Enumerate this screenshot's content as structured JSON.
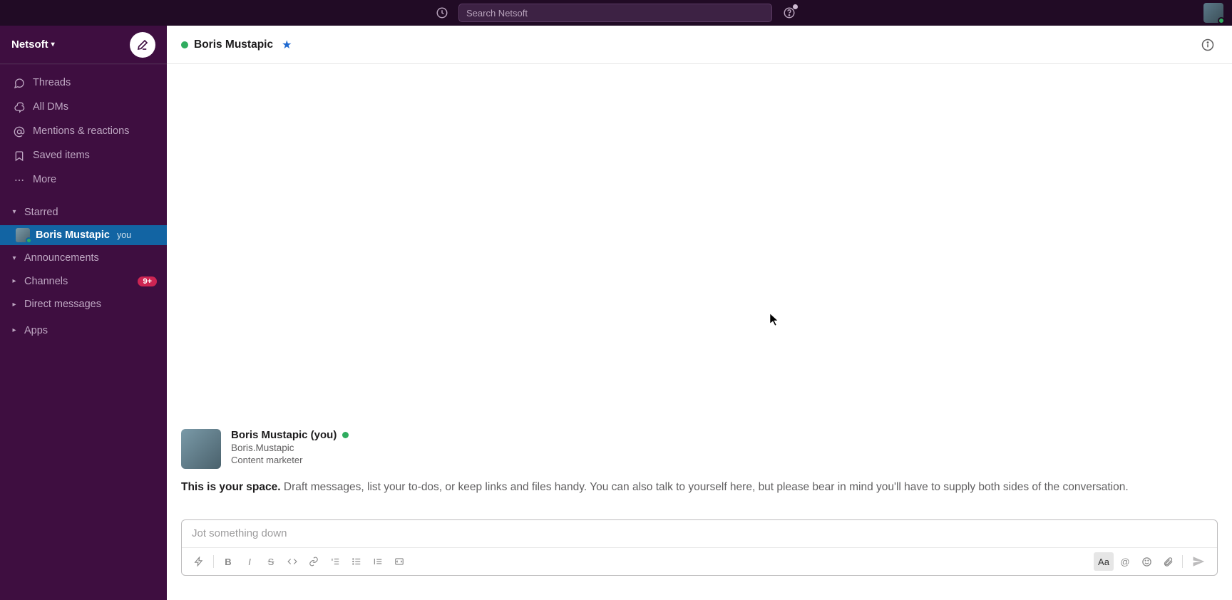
{
  "topbar": {
    "search_placeholder": "Search Netsoft"
  },
  "workspace": {
    "name": "Netsoft"
  },
  "sidebar": {
    "nav": [
      {
        "id": "threads",
        "label": "Threads",
        "icon": "threads"
      },
      {
        "id": "all-dms",
        "label": "All DMs",
        "icon": "dms"
      },
      {
        "id": "mentions",
        "label": "Mentions & reactions",
        "icon": "mentions"
      },
      {
        "id": "saved",
        "label": "Saved items",
        "icon": "saved"
      },
      {
        "id": "more",
        "label": "More",
        "icon": "more"
      }
    ],
    "sections": {
      "starred_label": "Starred",
      "announcements_label": "Announcements",
      "channels_label": "Channels",
      "channels_badge": "9+",
      "direct_messages_label": "Direct messages",
      "apps_label": "Apps"
    },
    "starred_dm": {
      "name": "Boris Mustapic",
      "you": "you"
    }
  },
  "chat": {
    "header_name": "Boris Mustapic",
    "profile": {
      "name_full": "Boris Mustapic (you)",
      "display_name": "Boris.Mustapic",
      "role": "Content marketer"
    },
    "space_bold": "This is your space.",
    "space_rest": " Draft messages, list your to-dos, or keep links and files handy. You can also talk to yourself here, but please bear in mind you'll have to supply both sides of the conversation."
  },
  "composer": {
    "placeholder": "Jot something down",
    "format_label": "Aa"
  }
}
